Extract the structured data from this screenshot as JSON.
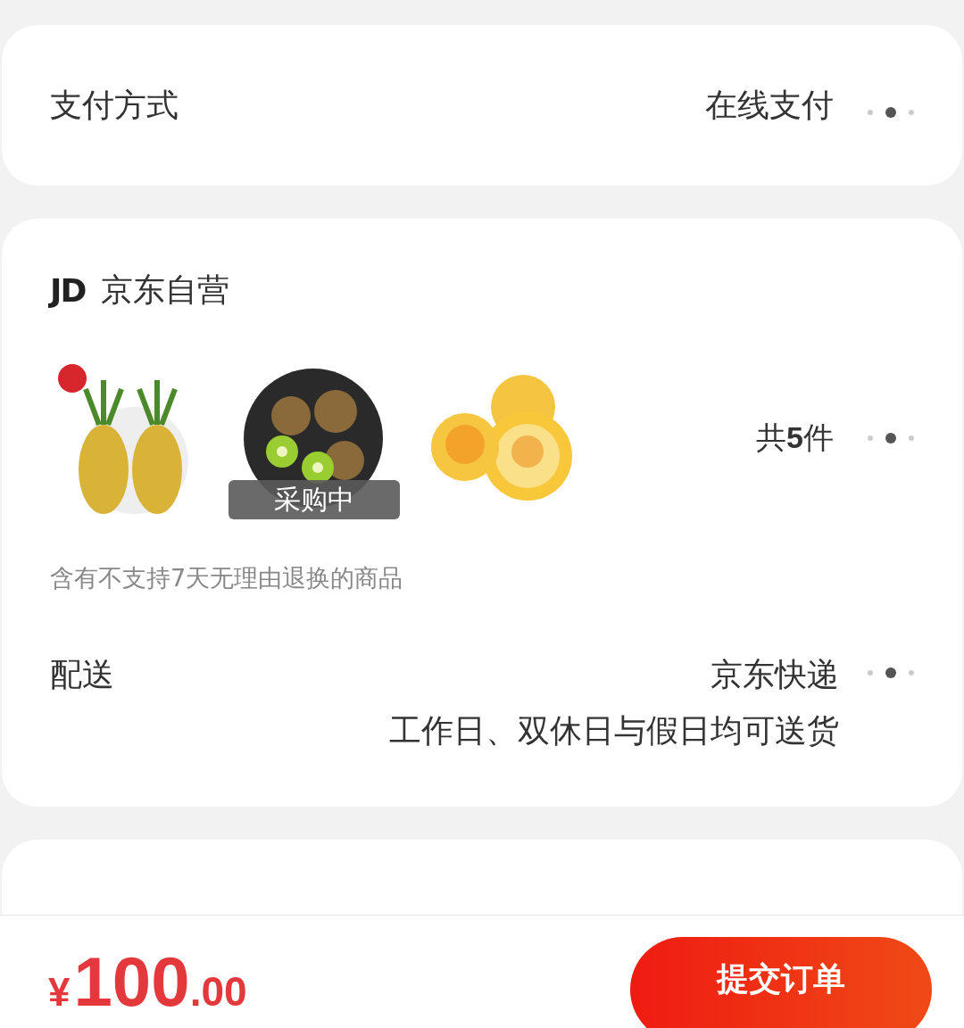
{
  "payment": {
    "label": "支付方式",
    "value": "在线支付"
  },
  "shop": {
    "logo": "JD",
    "name": "京东自营",
    "products": [
      {
        "kind": "pineapple"
      },
      {
        "kind": "kiwi",
        "badge": "采购中"
      },
      {
        "kind": "peach"
      }
    ],
    "count_prefix": "共",
    "count": "5",
    "count_suffix": "件",
    "notice": "含有不支持7天无理由退换的商品",
    "delivery": {
      "label": "配送",
      "value": "京东快递",
      "detail": "工作日、双休日与假日均可送货"
    }
  },
  "footer": {
    "currency": "¥",
    "amount": "100",
    "cents": ".00",
    "submit": "提交订单"
  }
}
